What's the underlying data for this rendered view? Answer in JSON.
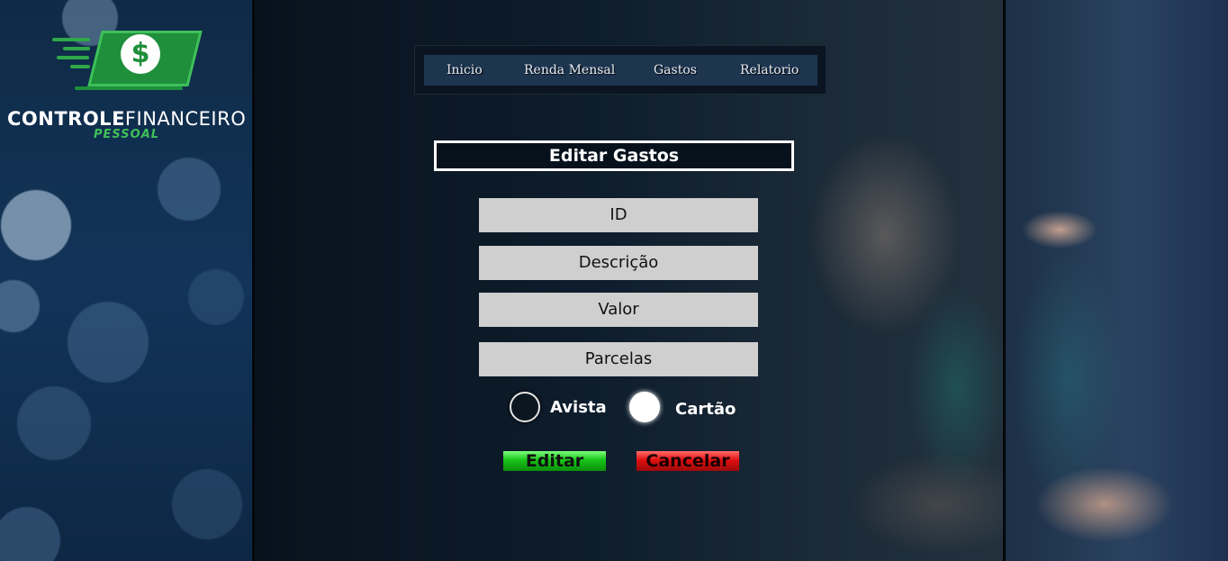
{
  "logo": {
    "title_bold": "CONTROLE",
    "title_light": "FINANCEIRO",
    "subtitle": "PESSOAL",
    "icon": "dollar-bill-icon",
    "colors": {
      "green": "#1f8f3b",
      "light_green": "#3fc05a"
    }
  },
  "nav": {
    "items": [
      {
        "label": "Inicio"
      },
      {
        "label": "Renda Mensal"
      },
      {
        "label": "Gastos"
      },
      {
        "label": "Relatorio"
      }
    ]
  },
  "form": {
    "title": "Editar Gastos",
    "fields": {
      "id": "ID",
      "descricao": "Descrição",
      "valor": "Valor",
      "parcelas": "Parcelas"
    },
    "payment": {
      "options": [
        {
          "label": "Avista",
          "selected": false
        },
        {
          "label": "Cartão",
          "selected": true
        }
      ]
    },
    "buttons": {
      "edit": "Editar",
      "cancel": "Cancelar"
    }
  },
  "colors": {
    "edit_button": "#18c418",
    "cancel_button": "#e01010",
    "nav_bar": "#1e3550"
  }
}
